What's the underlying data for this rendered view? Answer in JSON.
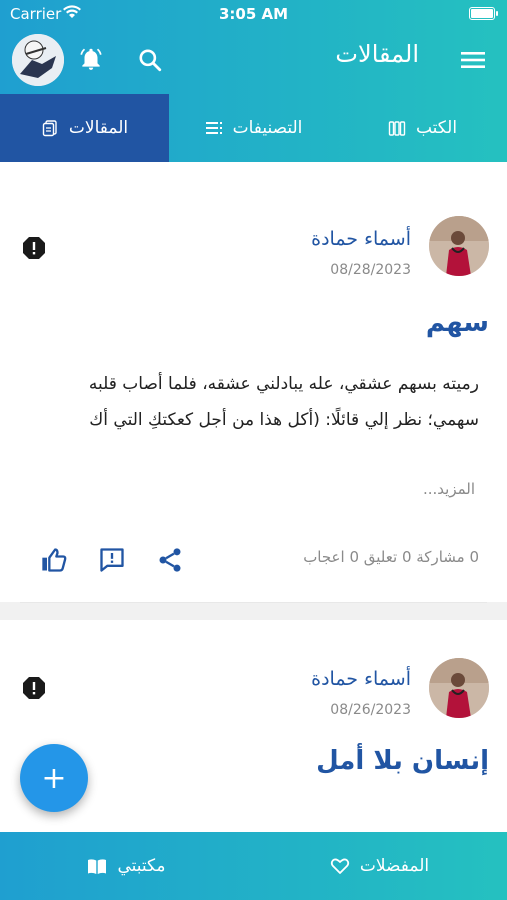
{
  "status_bar": {
    "carrier": "Carrier",
    "time": "3:05 AM"
  },
  "header": {
    "title": "المقالات"
  },
  "tabs": [
    {
      "label": "المقالات",
      "icon": "document-icon",
      "active": true
    },
    {
      "label": "التصنيفات",
      "icon": "list-icon",
      "active": false
    },
    {
      "label": "الكتب",
      "icon": "books-icon",
      "active": false
    }
  ],
  "posts": [
    {
      "author": "أسماء حمادة",
      "date": "08/28/2023",
      "title": "سهم",
      "body": "رميته بسهم عشقي، عله يبادلني عشقه، فلما أصاب قلبه سهمي؛ نظر إلي قائلًا: (أكل هذا من أجل كعكتكِ التي أك",
      "more": "...المزيد",
      "stats": "0 مشاركة  0 تعليق  0 اعجاب"
    },
    {
      "author": "أسماء حمادة",
      "date": "08/26/2023",
      "title": "إنسان بلا أمل"
    }
  ],
  "fab": {
    "label": "+"
  },
  "bottom_nav": [
    {
      "label": "مكتبتي",
      "icon": "open-book-icon"
    },
    {
      "label": "المفضلات",
      "icon": "heart-icon"
    }
  ],
  "colors": {
    "header_gradient_start": "#1f9fd0",
    "header_gradient_end": "#25c1c0",
    "active_tab": "#2155a3",
    "accent": "#2155a3",
    "fab": "#2496e8"
  }
}
